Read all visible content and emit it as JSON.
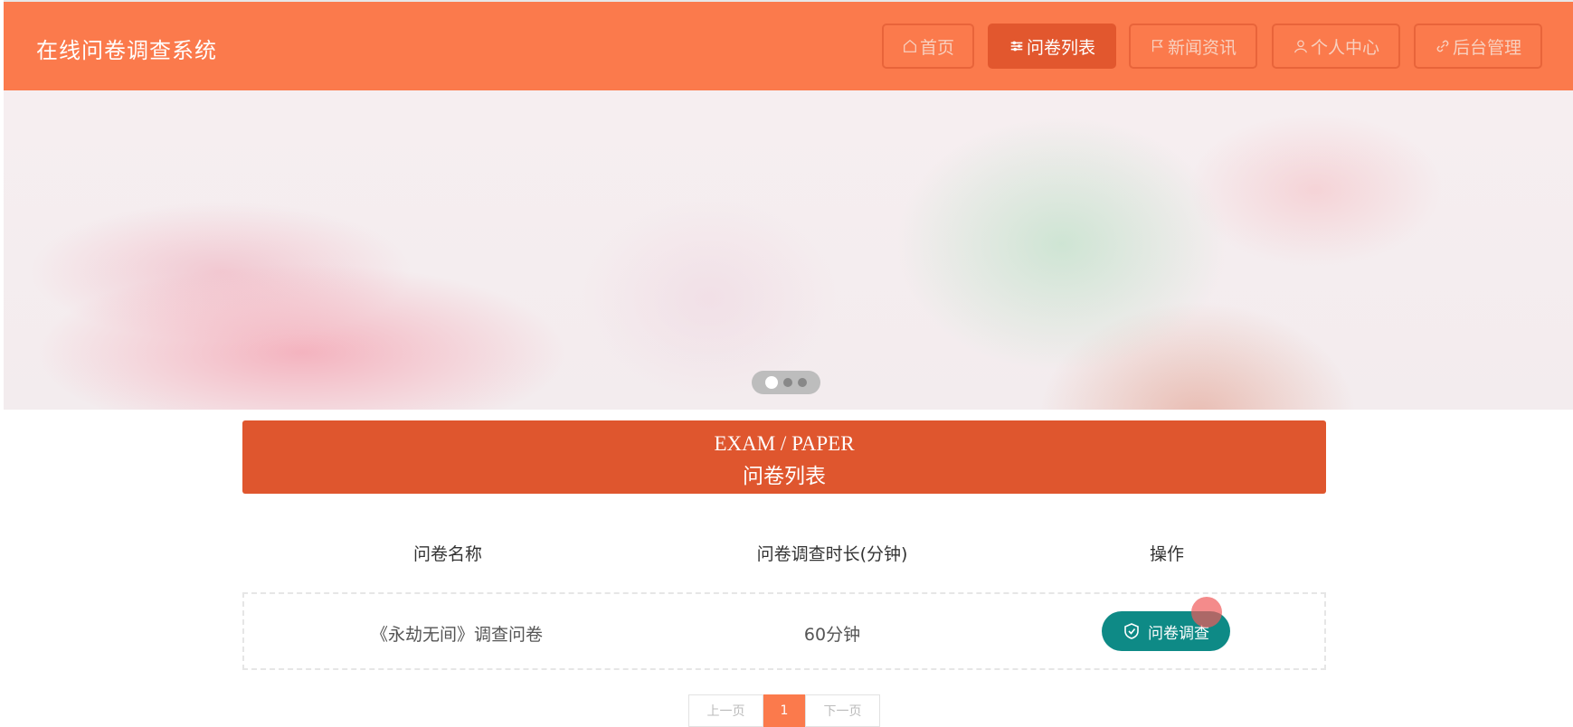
{
  "header": {
    "title": "在线问卷调查系统",
    "nav": [
      {
        "label": "首页",
        "icon": "home-icon",
        "active": false
      },
      {
        "label": "问卷列表",
        "icon": "sliders-icon",
        "active": true
      },
      {
        "label": "新闻资讯",
        "icon": "flag-icon",
        "active": false
      },
      {
        "label": "个人中心",
        "icon": "user-icon",
        "active": false
      },
      {
        "label": "后台管理",
        "icon": "link-icon",
        "active": false
      }
    ]
  },
  "carousel": {
    "slide_count": 3,
    "active_index": 0
  },
  "section": {
    "en_title": "EXAM / PAPER",
    "zh_title": "问卷列表"
  },
  "table": {
    "headers": [
      "问卷名称",
      "问卷调查时长(分钟)",
      "操作"
    ],
    "rows": [
      {
        "name": "《永劫无间》调查问卷",
        "duration": "60分钟",
        "action_label": "问卷调查",
        "action_icon": "shield-check-icon"
      }
    ]
  },
  "pagination": {
    "prev": "上一页",
    "current": "1",
    "next": "下一页"
  },
  "colors": {
    "header": "#fb7a4c",
    "accent": "#df562e",
    "action": "#0e8a86"
  }
}
